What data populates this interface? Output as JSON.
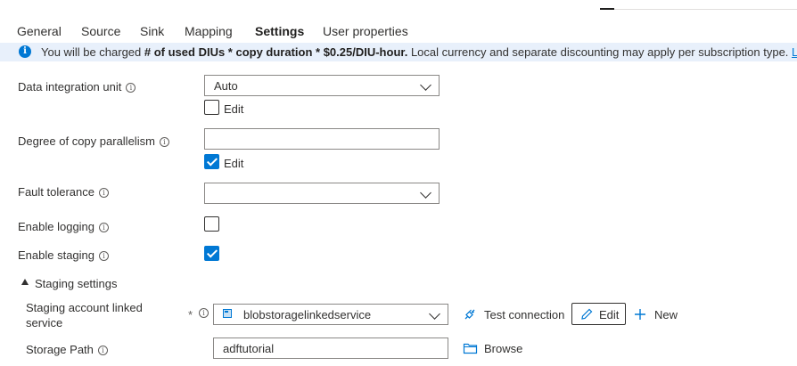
{
  "tabs": [
    {
      "label": "General",
      "active": false
    },
    {
      "label": "Source",
      "active": false
    },
    {
      "label": "Sink",
      "active": false
    },
    {
      "label": "Mapping",
      "active": false
    },
    {
      "label": "Settings",
      "active": true
    },
    {
      "label": "User properties",
      "active": false
    }
  ],
  "banner": {
    "prefix": "You will be charged ",
    "bold": "# of used DIUs * copy duration * $0.25/DIU-hour.",
    "suffix": " Local currency and separate discounting may apply per subscription type. ",
    "link": "L"
  },
  "diu": {
    "label": "Data integration unit",
    "value": "Auto",
    "edit_label": "Edit",
    "edit_checked": false
  },
  "parallelism": {
    "label": "Degree of copy parallelism",
    "value": "",
    "edit_label": "Edit",
    "edit_checked": true
  },
  "fault_tolerance": {
    "label": "Fault tolerance",
    "value": ""
  },
  "logging": {
    "label": "Enable logging",
    "checked": false
  },
  "staging": {
    "label": "Enable staging",
    "checked": true
  },
  "staging_settings": {
    "header": "Staging settings",
    "linked_service_label_1": "Staging account linked",
    "linked_service_label_2": "service",
    "required_mark": "*",
    "linked_service_value": "blobstoragelinkedservice",
    "test_connection": "Test connection",
    "edit": "Edit",
    "new": "New",
    "storage_path_label": "Storage Path",
    "storage_path_value": "adftutorial",
    "browse": "Browse"
  },
  "colors": {
    "accent": "#0078d4",
    "banner_bg": "#e8f0fb",
    "text": "#323130"
  }
}
